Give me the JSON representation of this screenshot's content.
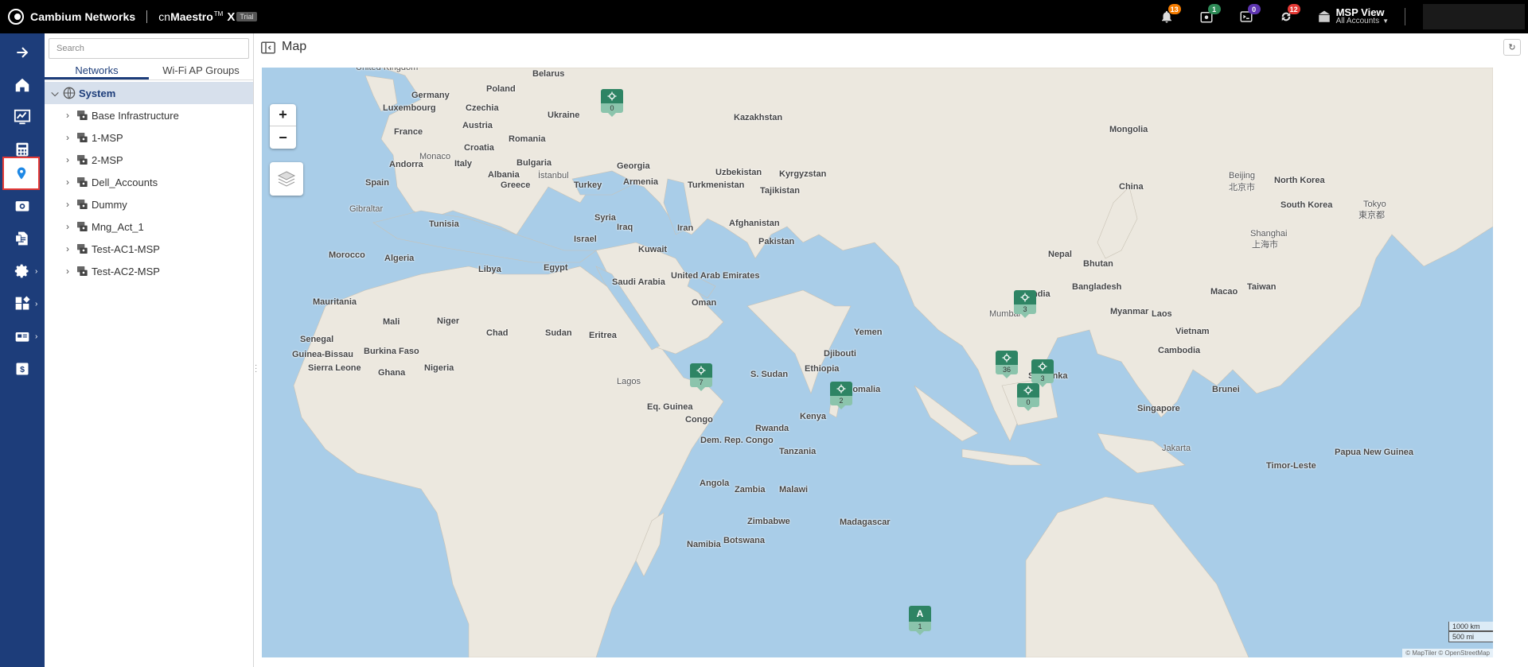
{
  "header": {
    "company": "Cambium Networks",
    "product_prefix": "cn",
    "product_name": "Maestro",
    "product_tm": "TM",
    "product_edition": "X",
    "product_tag": "Trial",
    "notifications": [
      {
        "icon": "bell-icon",
        "count": "13",
        "color": "#f57c00"
      },
      {
        "icon": "wifi-calendar-icon",
        "count": "1",
        "color": "#2e8b57"
      },
      {
        "icon": "terminal-icon",
        "count": "0",
        "color": "#5e35b1"
      },
      {
        "icon": "sync-alert-icon",
        "count": "12",
        "color": "#e53935"
      }
    ],
    "account_view": {
      "title": "MSP View",
      "subtitle": "All Accounts"
    }
  },
  "sidebar": {
    "items": [
      {
        "name": "expand-arrow-icon"
      },
      {
        "name": "home-icon"
      },
      {
        "name": "dashboard-icon"
      },
      {
        "name": "calculator-icon"
      },
      {
        "name": "map-pin-icon",
        "active": true
      },
      {
        "name": "wifi-camera-icon"
      },
      {
        "name": "report-icon"
      },
      {
        "name": "settings-icon"
      },
      {
        "name": "apps-icon"
      },
      {
        "name": "gateway-icon"
      },
      {
        "name": "dollar-icon"
      }
    ]
  },
  "tree_panel": {
    "search_placeholder": "Search",
    "tabs": [
      "Networks",
      "Wi-Fi AP Groups"
    ],
    "root": "System",
    "children": [
      "Base Infrastructure",
      "1-MSP",
      "2-MSP",
      "Dell_Accounts",
      "Dummy",
      "Mng_Act_1",
      "Test-AC1-MSP",
      "Test-AC2-MSP"
    ]
  },
  "main": {
    "title": "Map"
  },
  "map": {
    "scale_km": "1000 km",
    "scale_mi": "500 mi",
    "attribution": "© MapTiler © OpenStreetMap",
    "markers": [
      {
        "label": "0",
        "type": "site"
      },
      {
        "label": "7",
        "type": "site"
      },
      {
        "label": "2",
        "type": "site"
      },
      {
        "label": "3",
        "type": "site"
      },
      {
        "label": "36",
        "type": "site"
      },
      {
        "label": "3",
        "type": "site"
      },
      {
        "label": "0",
        "type": "site"
      },
      {
        "label": "1",
        "type": "ap",
        "glyph": "A"
      }
    ],
    "labels": {
      "united_kingdom": "United Kingdom",
      "belarus": "Belarus",
      "germany": "Germany",
      "poland": "Poland",
      "luxembourg": "Luxembourg",
      "czechia": "Czechia",
      "ukraine": "Ukraine",
      "kazakhstan": "Kazakhstan",
      "austria": "Austria",
      "france": "France",
      "romania": "Romania",
      "croatia": "Croatia",
      "mongolia": "Mongolia",
      "monaco": "Monaco",
      "andorra": "Andorra",
      "italy": "Italy",
      "bulgaria": "Bulgaria",
      "georgia": "Georgia",
      "uzbekistan": "Uzbekistan",
      "kyrgyzstan": "Kyrgyzstan",
      "albania": "Albania",
      "istanbul": "İstanbul",
      "spain": "Spain",
      "greece": "Greece",
      "armenia": "Armenia",
      "turkey": "Turkey",
      "turkmenistan": "Turkmenistan",
      "tajikistan": "Tajikistan",
      "beijing": "Beijing",
      "beijing_cn": "北京市",
      "north_korea": "North Korea",
      "china": "China",
      "gibraltar": "Gibraltar",
      "syria": "Syria",
      "south_korea": "South Korea",
      "tokyo": "Tokyo",
      "tokyo_jp": "東京都",
      "tunisia": "Tunisia",
      "iraq": "Iraq",
      "iran": "Iran",
      "afghanistan": "Afghanistan",
      "shanghai": "Shanghai",
      "shanghai_cn": "上海市",
      "israel": "Israel",
      "pakistan": "Pakistan",
      "kuwait": "Kuwait",
      "morocco": "Morocco",
      "algeria": "Algeria",
      "libya": "Libya",
      "egypt": "Egypt",
      "nepal": "Nepal",
      "bhutan": "Bhutan",
      "saudi_arabia": "Saudi Arabia",
      "uae": "United Arab Emirates",
      "bangladesh": "Bangladesh",
      "taiwan": "Taiwan",
      "india": "India",
      "macao": "Macao",
      "mauritania": "Mauritania",
      "oman": "Oman",
      "myanmar": "Myanmar",
      "mumbai": "Mumbai",
      "laos": "Laos",
      "mali": "Mali",
      "niger": "Niger",
      "chad": "Chad",
      "sudan": "Sudan",
      "eritrea": "Eritrea",
      "yemen": "Yemen",
      "vietnam": "Vietnam",
      "senegal": "Senegal",
      "guinea_bissau": "Guinea-Bissau",
      "burkina_faso": "Burkina Faso",
      "djibouti": "Djibouti",
      "cambodia": "Cambodia",
      "nigeria": "Nigeria",
      "ethiopia": "Ethiopia",
      "sierra_leone": "Sierra Leone",
      "ghana": "Ghana",
      "s_sudan": "S. Sudan",
      "sri_lanka": "Sri Lanka",
      "lagos": "Lagos",
      "somalia": "Somalia",
      "brunei": "Brunei",
      "eq_guinea": "Eq. Guinea",
      "singapore": "Singapore",
      "kenya": "Kenya",
      "congo": "Congo",
      "rwanda": "Rwanda",
      "dem_rep_congo": "Dem. Rep. Congo",
      "tanzania": "Tanzania",
      "jakarta": "Jakarta",
      "papua": "Papua New Guinea",
      "timor": "Timor-Leste",
      "angola": "Angola",
      "zambia": "Zambia",
      "malawi": "Malawi",
      "zimbabwe": "Zimbabwe",
      "madagascar": "Madagascar",
      "botswana": "Botswana",
      "namibia": "Namibia"
    }
  }
}
